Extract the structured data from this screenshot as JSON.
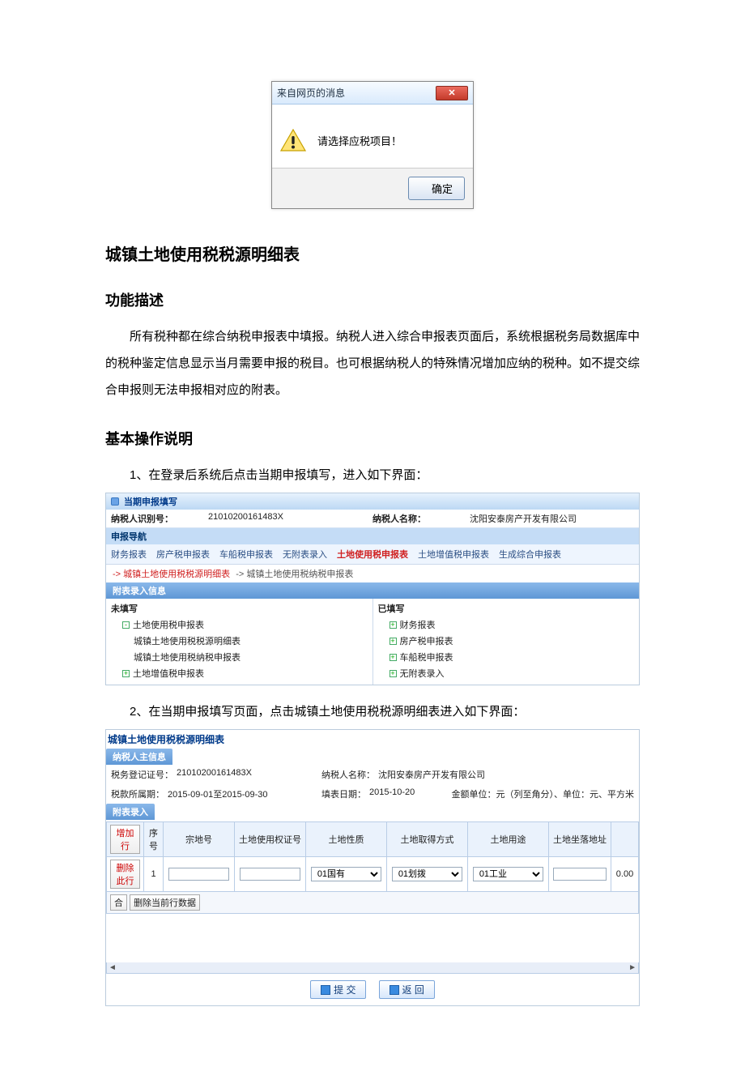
{
  "dialog": {
    "title": "来自网页的消息",
    "close_glyph": "✕",
    "message": "请选择应税项目！",
    "ok_label": "确定"
  },
  "headings": {
    "section1": "城镇土地使用税税源明细表",
    "func_title": "功能描述",
    "func_body": "所有税种都在综合纳税申报表中填报。纳税人进入综合申报表页面后，系统根据税务局数据库中的税种鉴定信息显示当月需要申报的税目。也可根据纳税人的特殊情况增加应纳的税种。如不提交综合申报则无法申报相对应的附表。",
    "ops_title": "基本操作说明",
    "step1": "1、在登录后系统后点击当期申报填写，进入如下界面：",
    "step2": "2、在当期申报填写页面，点击城镇土地使用税税源明细表进入如下界面："
  },
  "shot1": {
    "window_title": "当期申报填写",
    "taxpayer_id_label": "纳税人识别号：",
    "taxpayer_id_value": "21010200161483X",
    "taxpayer_name_label": "纳税人名称：",
    "taxpayer_name_value": "沈阳安泰房产开发有限公司",
    "nav_header": "申报导航",
    "tabs": [
      "财务报表",
      "房产税申报表",
      "车船税申报表",
      "无附表录入",
      "土地使用税申报表",
      "土地增值税申报表",
      "生成综合申报表"
    ],
    "crumb_active": "-> 城镇土地使用税税源明细表",
    "crumb_next": "-> 城镇土地使用税纳税申报表",
    "entry_header": "附表录入信息",
    "left_title": "未填写",
    "left_root": "土地使用税申报表",
    "left_children": [
      "城镇土地使用税税源明细表",
      "城镇土地使用税纳税申报表"
    ],
    "left_root2": "土地增值税申报表",
    "right_title": "已填写",
    "right_items": [
      "财务报表",
      "房产税申报表",
      "车船税申报表",
      "无附表录入"
    ]
  },
  "shot2": {
    "window_title": "城镇土地使用税税源明细表",
    "sub_header": "纳税人主信息",
    "reg_label": "税务登记证号：",
    "reg_value": "21010200161483X",
    "period_label": "税款所属期：",
    "period_value": "2015-09-01至2015-09-30",
    "name_label": "纳税人名称：",
    "name_value": "沈阳安泰房产开发有限公司",
    "fill_date_label": "填表日期：",
    "fill_date_value": "2015-10-20",
    "unit_note": "金额单位：元（列至角分）、单位：元、平方米",
    "entry_header": "附表录入",
    "columns": [
      "增加行",
      "序号",
      "宗地号",
      "土地使用权证号",
      "土地性质",
      "土地取得方式",
      "土地用途",
      "土地坐落地址",
      ""
    ],
    "row": {
      "delete_label": "删除此行",
      "seq": "1",
      "nature": "01国有",
      "acquire": "01划拨",
      "usage": "01工业",
      "last_val": "0.00"
    },
    "merge_btn": "合",
    "clear_btn": "删除当前行数据",
    "submit_label": "提 交",
    "back_label": "返 回"
  }
}
